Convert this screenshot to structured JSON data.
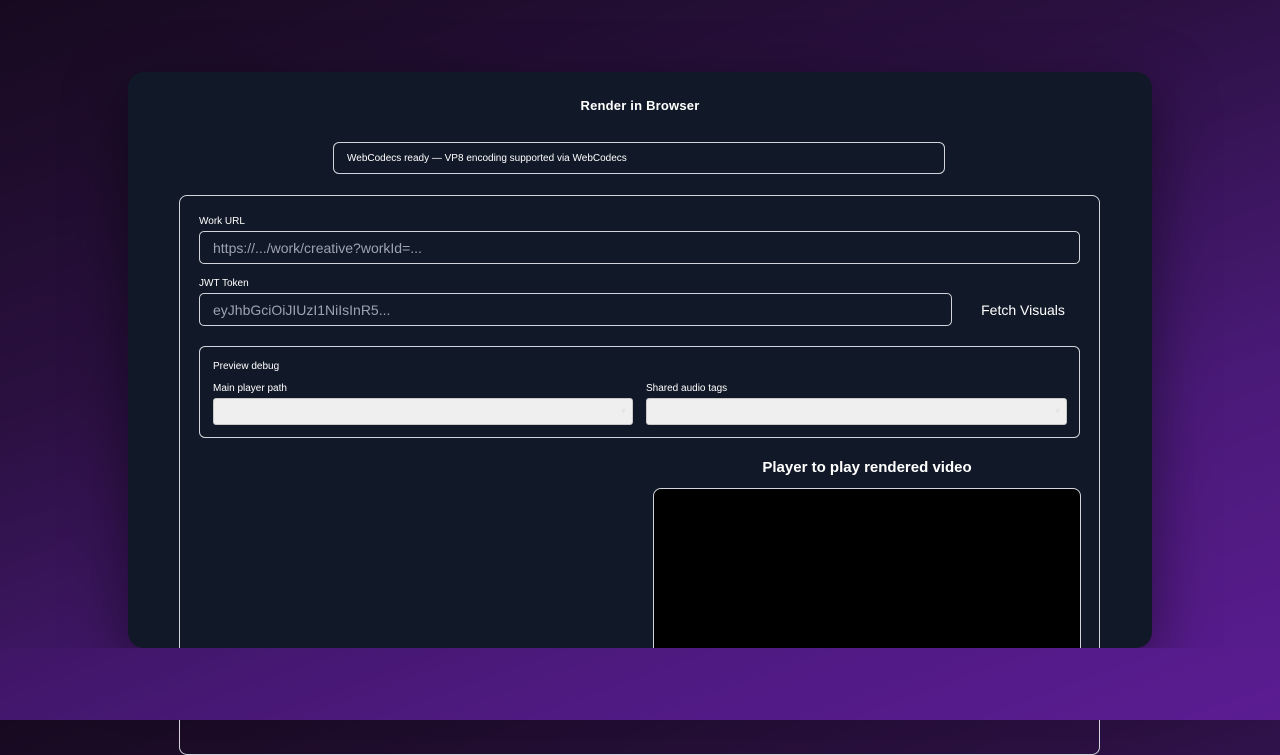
{
  "page": {
    "title": "Render in Browser"
  },
  "status": {
    "text": "WebCodecs ready — VP8 encoding supported via WebCodecs"
  },
  "form": {
    "work_url_label": "Work URL",
    "work_url_placeholder": "https://.../work/creative?workId=...",
    "jwt_label": "JWT Token",
    "jwt_placeholder": "eyJhbGciOiJIUzI1NiIsInR5...",
    "fetch_button": "Fetch Visuals"
  },
  "debug": {
    "title": "Preview debug",
    "main_player_label": "Main player path",
    "main_player_value": "",
    "shared_audio_label": "Shared audio tags",
    "shared_audio_value": ""
  },
  "player": {
    "title": "Player to play rendered video"
  },
  "colors": {
    "card_bg": "#111827",
    "border": "#d1d5db",
    "video_bg": "#000000"
  }
}
